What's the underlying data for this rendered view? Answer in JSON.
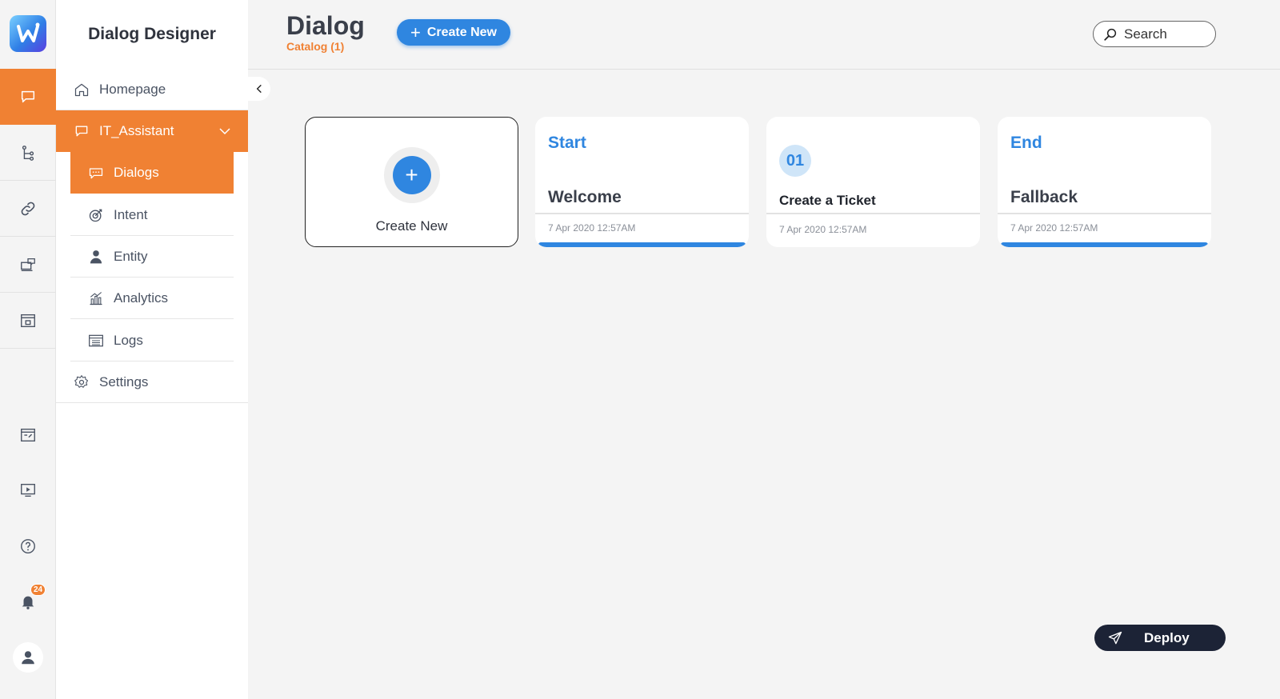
{
  "app": {
    "name": "Dialog Designer"
  },
  "rail": {
    "items": [
      {
        "icon": "chat-icon",
        "active": true
      },
      {
        "icon": "flow-icon",
        "active": false
      },
      {
        "icon": "link-icon",
        "active": false
      },
      {
        "icon": "support-icon",
        "active": false
      },
      {
        "icon": "archive-icon",
        "active": false
      }
    ],
    "bottom": [
      {
        "icon": "form-icon"
      },
      {
        "icon": "video-icon"
      },
      {
        "icon": "help-icon"
      },
      {
        "icon": "bell-icon",
        "badge": "24"
      },
      {
        "icon": "user-icon"
      }
    ]
  },
  "sidebar": {
    "homepage": "Homepage",
    "group": "IT_Assistant",
    "items": [
      "Dialogs",
      "Intent",
      "Entity",
      "Analytics",
      "Logs"
    ],
    "settings": "Settings"
  },
  "header": {
    "title": "Dialog",
    "subtitle": "Catalog (1)",
    "create_label": "Create New",
    "search_label": "Search"
  },
  "cards": {
    "new_label": "Create New",
    "items": [
      {
        "tag": "Start",
        "name": "Welcome",
        "date": "7 Apr 2020  12:57AM"
      },
      {
        "number": "01",
        "name": "Create a Ticket",
        "date": "7 Apr 2020  12:57AM"
      },
      {
        "tag": "End",
        "name": "Fallback",
        "date": "7 Apr 2020  12:57AM"
      }
    ]
  },
  "deploy_label": "Deploy",
  "colors": {
    "accent": "#f08133",
    "primary": "#2f86e0",
    "dark": "#1c2336"
  }
}
